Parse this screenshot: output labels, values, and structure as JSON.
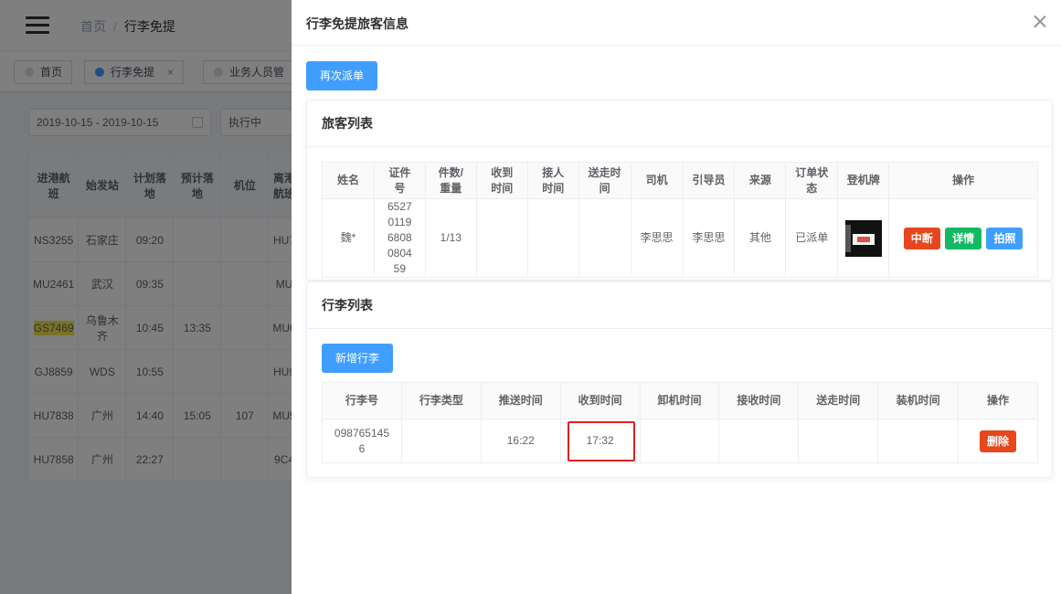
{
  "breadcrumb": {
    "home": "首页",
    "separator": "/",
    "current": "行李免提"
  },
  "tags": [
    {
      "label": "首页",
      "close": ""
    },
    {
      "label": "行李免提",
      "close": "×"
    },
    {
      "label": "业务人员管",
      "close": ""
    }
  ],
  "filters": {
    "date_range": "2019-10-15 - 2019-10-15",
    "status": "执行中"
  },
  "flight_table": {
    "headers": [
      "进港航班",
      "始发站",
      "计划落地",
      "预计落地",
      "机位",
      "离港航班"
    ],
    "rows": [
      [
        "NS3255",
        "石家庄",
        "09:20",
        "",
        "",
        "HU7"
      ],
      [
        "MU2461",
        "武汉",
        "09:35",
        "",
        "",
        "MU"
      ],
      [
        "GS7469",
        "乌鲁木齐",
        "10:45",
        "13:35",
        "",
        "MU0"
      ],
      [
        "GJ8859",
        "WDS",
        "10:55",
        "",
        "",
        "HU9"
      ],
      [
        "HU7838",
        "广州",
        "14:40",
        "15:05",
        "107",
        "MU5"
      ],
      [
        "HU7858",
        "广州",
        "22:27",
        "",
        "",
        "9C4"
      ]
    ]
  },
  "drawer": {
    "title": "行李免提旅客信息",
    "redispatch_label": "再次派单",
    "passenger_section": {
      "title": "旅客列表",
      "headers": [
        "姓名",
        "证件号",
        "件数/重量",
        "收到时间",
        "接人时间",
        "送走时间",
        "司机",
        "引导员",
        "来源",
        "订单状态",
        "登机牌",
        "操作"
      ],
      "row": {
        "name": "魏*",
        "id_number": "652701196808080459",
        "count_weight": "1/13",
        "received_time": "",
        "pickup_time": "",
        "sendoff_time": "",
        "driver": "李思思",
        "guide": "李思思",
        "source": "其他",
        "status": "已派单"
      },
      "actions": {
        "interrupt": "中断",
        "detail": "详情",
        "photo": "拍照"
      }
    },
    "luggage_section": {
      "title": "行李列表",
      "add_label": "新增行李",
      "headers": [
        "行李号",
        "行李类型",
        "推送时间",
        "收到时间",
        "卸机时间",
        "接收时间",
        "送走时间",
        "装机时间",
        "操作"
      ],
      "row": {
        "luggage_no": "0987651456",
        "type": "",
        "push_time": "16:22",
        "received_time": "17:32",
        "unload_time": "",
        "accept_time": "",
        "sendoff_time": "",
        "load_time": ""
      },
      "delete_label": "删除"
    }
  }
}
